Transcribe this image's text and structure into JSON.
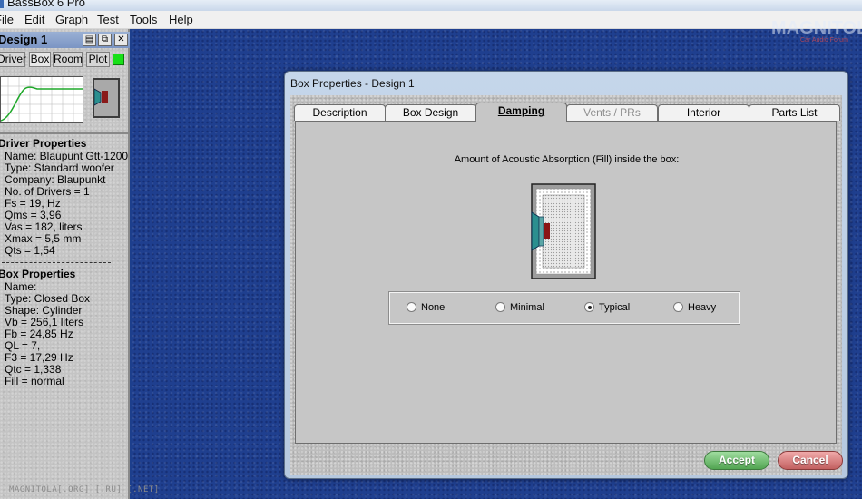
{
  "window": {
    "title": "BassBox 6 Pro"
  },
  "menu": [
    "File",
    "Edit",
    "Graph",
    "Test",
    "Tools",
    "Help"
  ],
  "logo": {
    "text": "MAGNITOLA",
    "sub": "Car Audio Forum"
  },
  "watermark": "MAGNITOLA[.ORG] [.RU] [.NET]",
  "left_panel": {
    "design_title": "Design 1",
    "tabs": [
      "Driver",
      "Box",
      "Room",
      "Plot"
    ],
    "plot_led_color": "#18e018",
    "driver_properties": {
      "title": "Driver Properties",
      "lines": [
        "Name: Blaupunt Gtt-1200",
        "Type: Standard woofer",
        "Company: Blaupunkt",
        "No. of Drivers = 1",
        "Fs = 19, Hz",
        "Qms = 3,96",
        "Vas = 182, liters",
        "Xmax = 5,5 mm",
        "Qts = 1,54"
      ]
    },
    "box_properties": {
      "title": "Box Properties",
      "lines": [
        "Name:",
        "Type: Closed Box",
        "Shape: Cylinder",
        "Vb = 256,1 liters",
        "Fb = 24,85 Hz",
        "QL = 7,",
        "F3 = 17,29 Hz",
        "Qtc = 1,338",
        "Fill = normal"
      ]
    }
  },
  "dialog": {
    "title": "Box Properties - Design 1",
    "tabs": [
      {
        "label": "Description",
        "state": "normal"
      },
      {
        "label": "Box Design",
        "state": "normal"
      },
      {
        "label": "Damping",
        "state": "active"
      },
      {
        "label": "Vents / PRs",
        "state": "disabled"
      },
      {
        "label": "Interior",
        "state": "normal"
      },
      {
        "label": "Parts List",
        "state": "normal"
      }
    ],
    "fill_label": "Amount of Acoustic Absorption (Fill) inside the box:",
    "options": [
      {
        "label": "None",
        "checked": false
      },
      {
        "label": "Minimal",
        "checked": false
      },
      {
        "label": "Typical",
        "checked": true
      },
      {
        "label": "Heavy",
        "checked": false
      }
    ],
    "accept_label": "Accept",
    "cancel_label": "Cancel",
    "accept_color": "#52a552",
    "cancel_color": "#c26060"
  }
}
